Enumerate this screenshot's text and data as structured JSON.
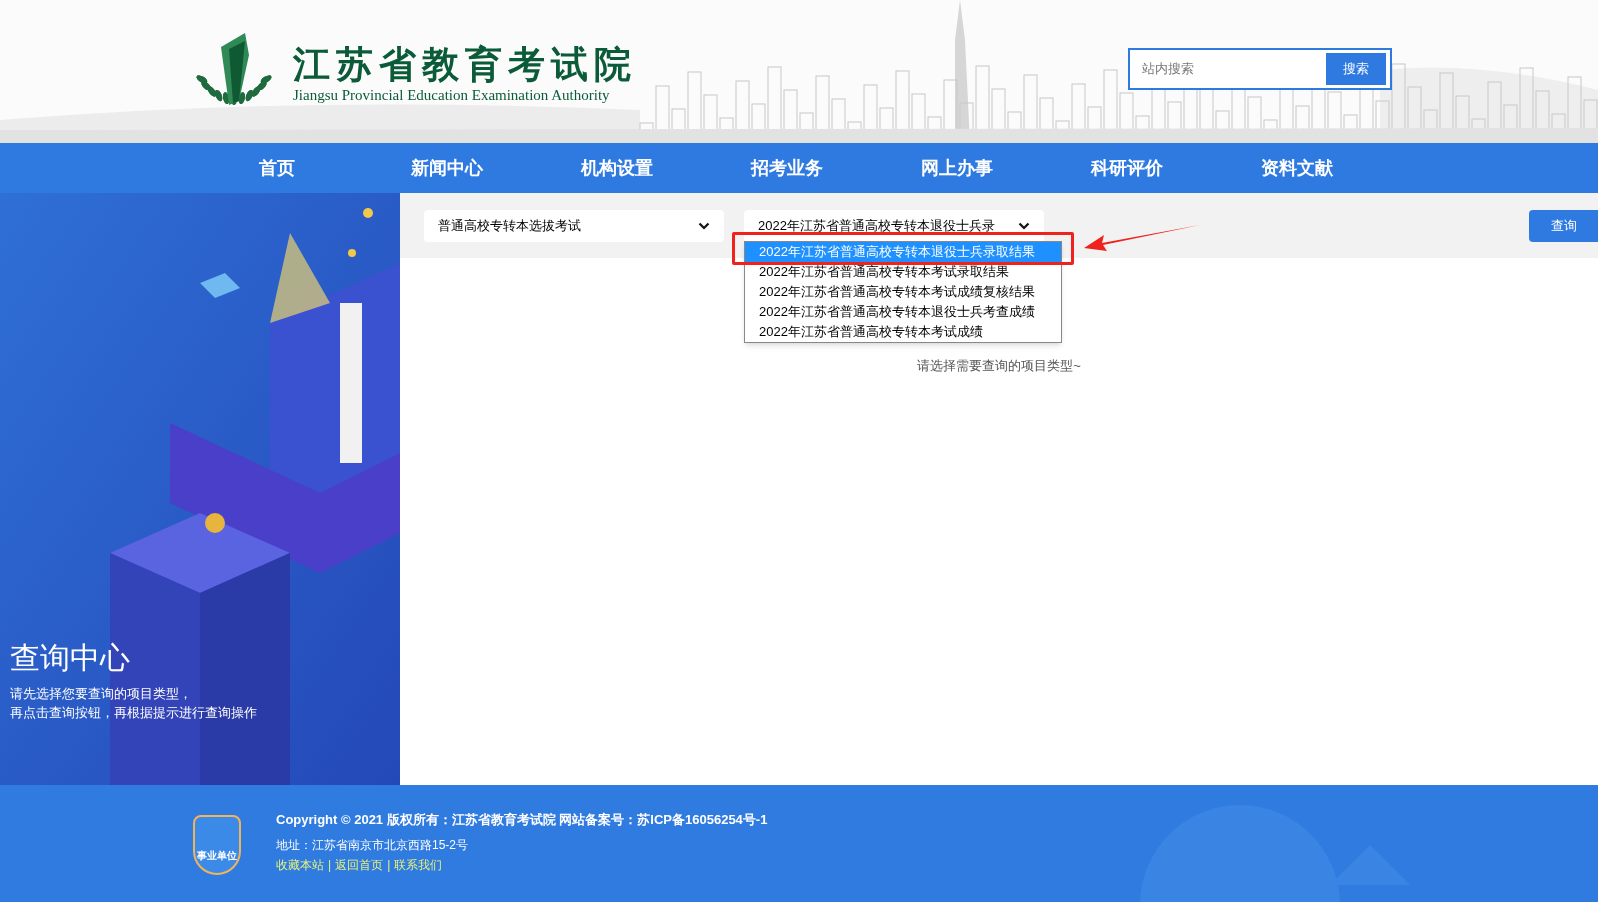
{
  "header": {
    "title": "江苏省教育考试院",
    "subtitle": "Jiangsu Provincial Education Examination Authority",
    "search": {
      "placeholder": "站内搜索",
      "button": "搜索"
    }
  },
  "nav": [
    {
      "label": "首页"
    },
    {
      "label": "新闻中心"
    },
    {
      "label": "机构设置"
    },
    {
      "label": "招考业务"
    },
    {
      "label": "网上办事"
    },
    {
      "label": "科研评价"
    },
    {
      "label": "资料文献"
    }
  ],
  "sidebar": {
    "title": "查询中心",
    "lines": [
      "请先选择您要查询的项目类型，",
      "再点击查询按钮，再根据提示进行查询操作"
    ]
  },
  "query": {
    "category_select": {
      "value": "普通高校专转本选拔考试"
    },
    "item_select": {
      "value": "2022年江苏省普通高校专转本退役士兵录",
      "expanded": true,
      "options": [
        {
          "label": "2022年江苏省普通高校专转本退役士兵录取结果",
          "selected": true
        },
        {
          "label": "2022年江苏省普通高校专转本考试录取结果",
          "selected": false
        },
        {
          "label": "2022年江苏省普通高校专转本考试成绩复核结果",
          "selected": false
        },
        {
          "label": "2022年江苏省普通高校专转本退役士兵考查成绩",
          "selected": false
        },
        {
          "label": "2022年江苏省普通高校专转本考试成绩",
          "selected": false
        }
      ]
    },
    "button": "查询",
    "hint": "请选择需要查询的项目类型~"
  },
  "footer": {
    "badge": "事业单位",
    "copyright": "Copyright © 2021 版权所有：江苏省教育考试院 网站备案号：苏ICP备16056254号-1",
    "address": "地址：江苏省南京市北京西路15-2号",
    "links": [
      "收藏本站",
      "返回首页",
      "联系我们"
    ],
    "separator": "|"
  }
}
